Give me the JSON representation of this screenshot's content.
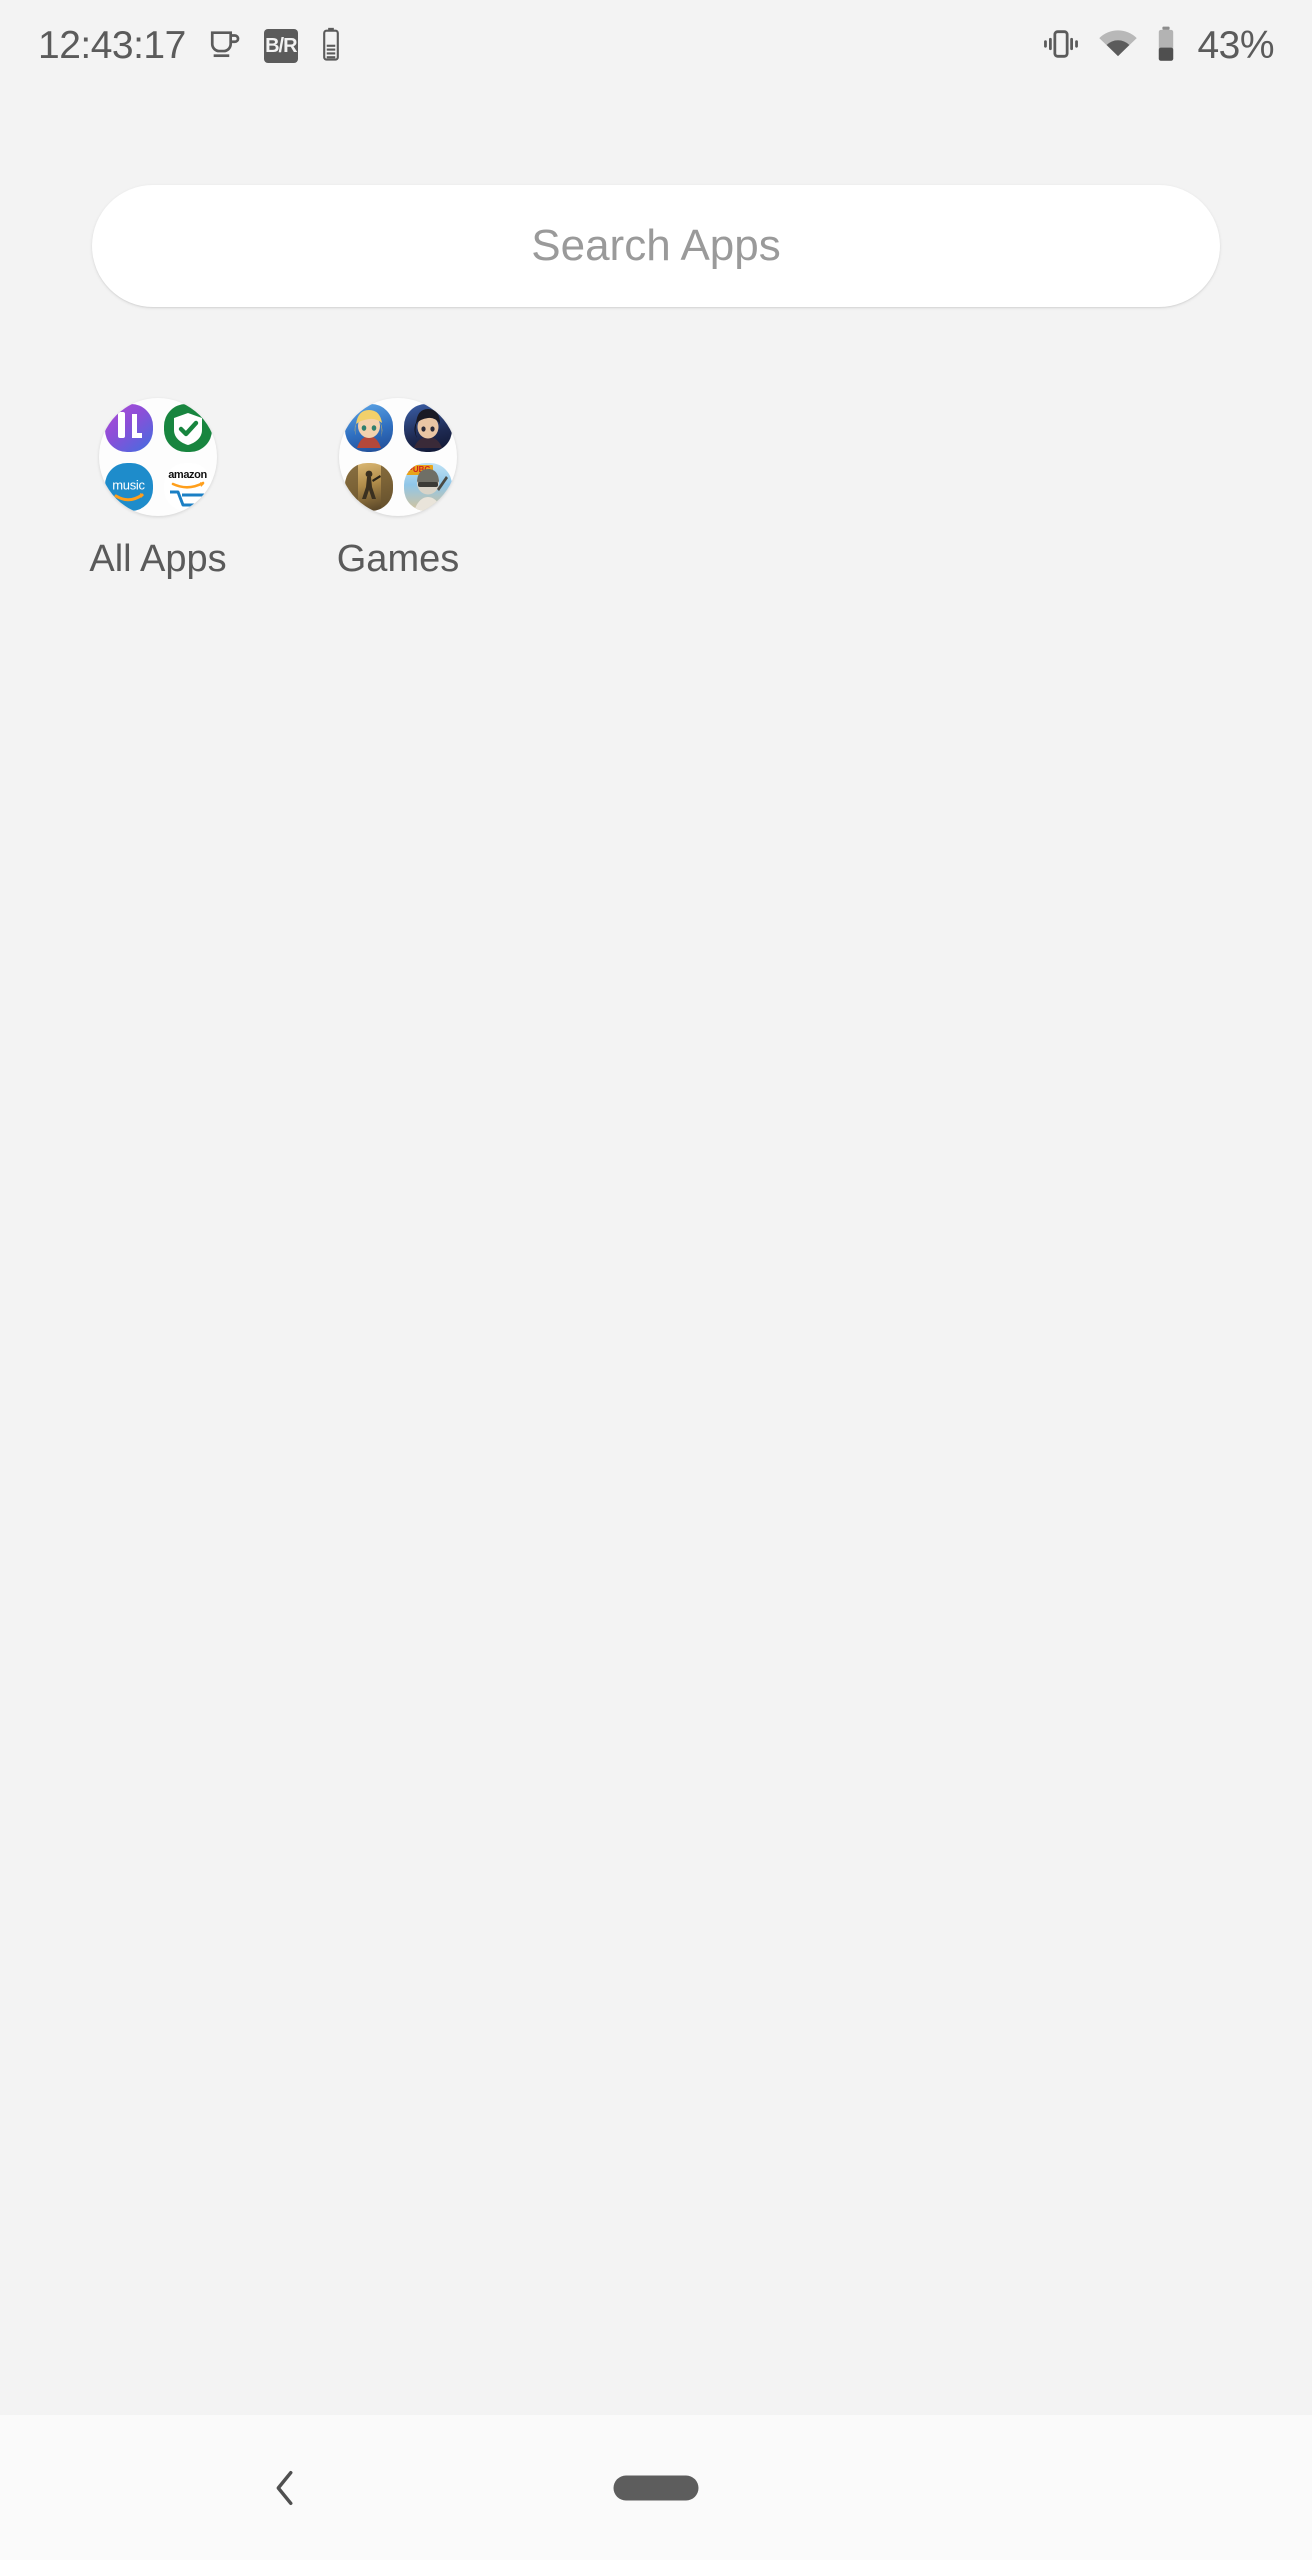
{
  "status_bar": {
    "clock": "12:43:17",
    "battery_percent": "43%",
    "left_icons": [
      {
        "name": "coffee-cup-icon",
        "label": ""
      },
      {
        "name": "br-badge-icon",
        "label": "B/R"
      },
      {
        "name": "battery-saver-icon",
        "label": ""
      }
    ],
    "right_icons": [
      {
        "name": "vibrate-icon",
        "label": ""
      },
      {
        "name": "wifi-icon",
        "label": ""
      },
      {
        "name": "battery-icon",
        "label": ""
      }
    ],
    "text_color": "#5b5b5b"
  },
  "search": {
    "placeholder": "Search Apps",
    "value": "",
    "background": "#ffffff",
    "placeholder_color": "#9a9a9a"
  },
  "folders": [
    {
      "label": "All Apps",
      "name": "folder-all-apps",
      "apps": [
        {
          "name": "lightroom-app-icon",
          "label": "L"
        },
        {
          "name": "security-check-app-icon",
          "label": ""
        },
        {
          "name": "amazon-music-app-icon",
          "label": "music"
        },
        {
          "name": "amazon-shopping-app-icon",
          "label": "amazon"
        }
      ]
    },
    {
      "label": "Games",
      "name": "folder-games",
      "apps": [
        {
          "name": "anime-rpg-app-icon",
          "label": ""
        },
        {
          "name": "anime-action-app-icon",
          "label": ""
        },
        {
          "name": "desert-survival-app-icon",
          "label": ""
        },
        {
          "name": "pubg-mobile-app-icon",
          "label": "PUBG"
        }
      ]
    }
  ],
  "nav_bar": {
    "back_label": "Back",
    "home_label": "Home",
    "background": "#fafafa"
  },
  "theme": {
    "wallpaper": "#f3f3f3",
    "icon_tint": "#5b5b5b",
    "label_color": "#5a5a5a"
  }
}
